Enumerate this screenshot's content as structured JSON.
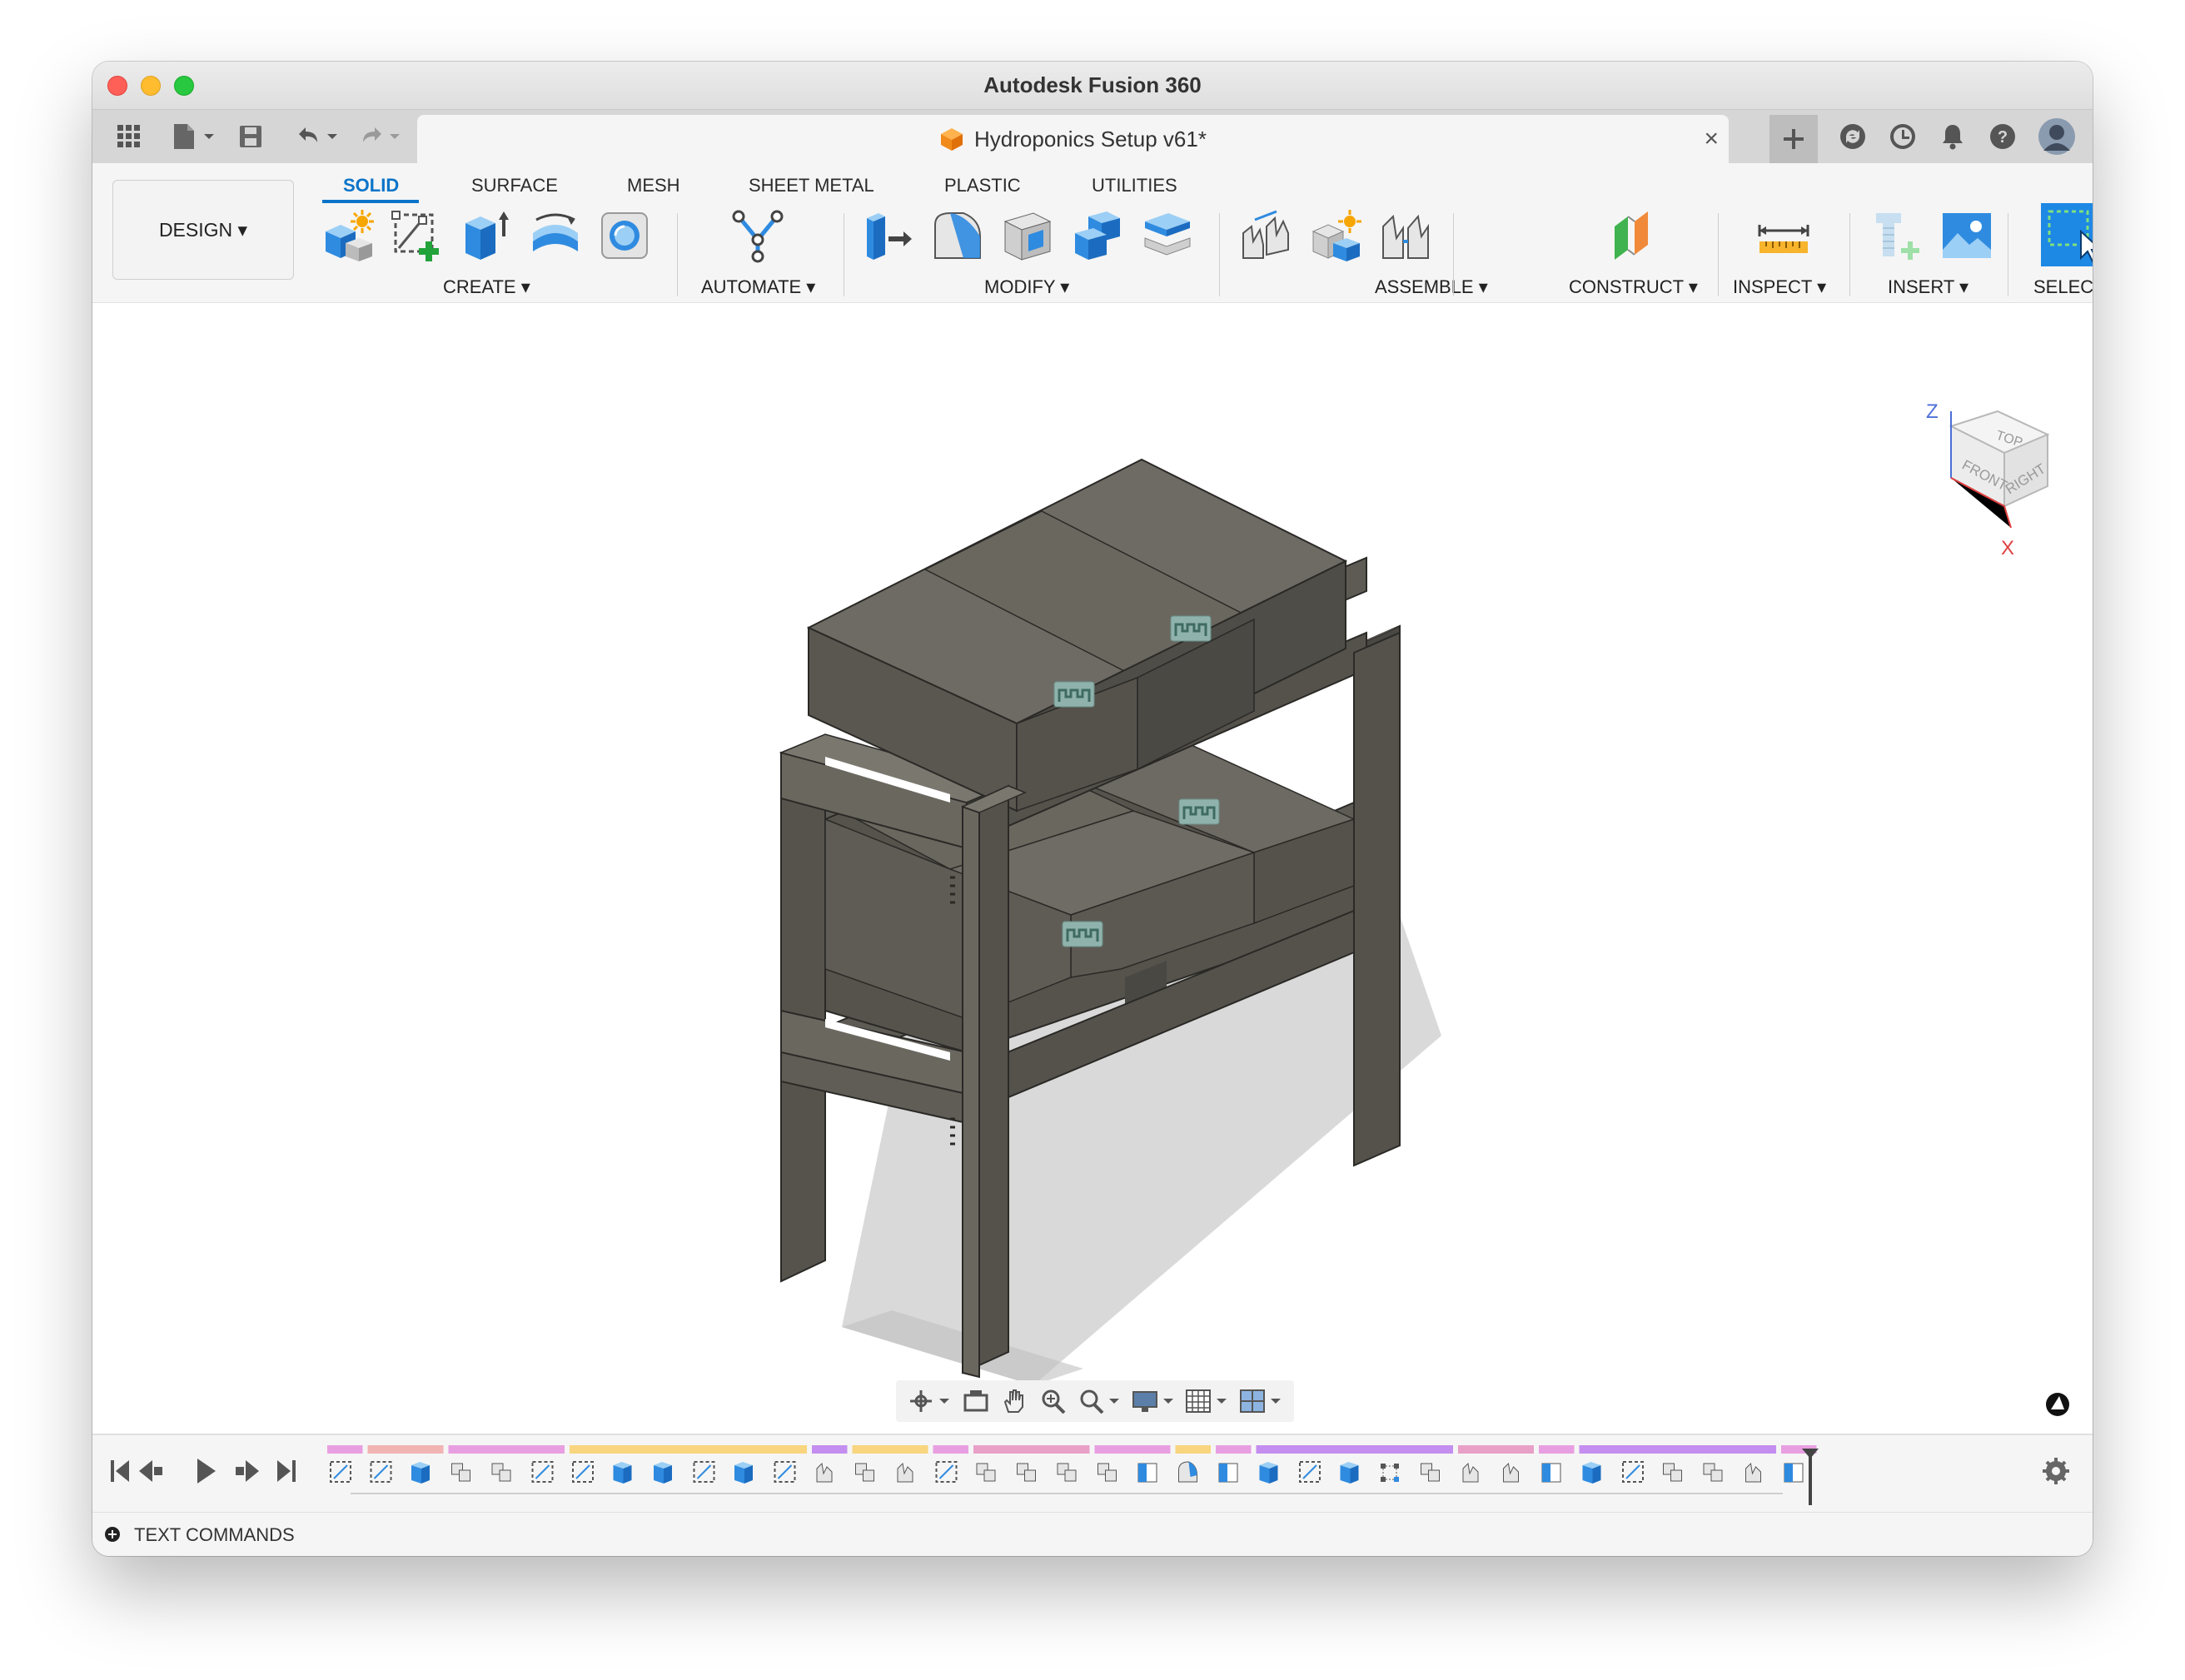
{
  "window": {
    "title": "Autodesk Fusion 360"
  },
  "document_tab": {
    "name": "Hydroponics Setup v61*"
  },
  "workspace": {
    "label": "DESIGN ▾"
  },
  "ribbon_tabs": [
    {
      "label": "SOLID",
      "active": true
    },
    {
      "label": "SURFACE",
      "active": false
    },
    {
      "label": "MESH",
      "active": false
    },
    {
      "label": "SHEET METAL",
      "active": false
    },
    {
      "label": "PLASTIC",
      "active": false
    },
    {
      "label": "UTILITIES",
      "active": false
    }
  ],
  "tool_groups": [
    {
      "label": "CREATE ▾",
      "tools": [
        "new-component",
        "create-sketch",
        "extrude",
        "revolve",
        "hole"
      ]
    },
    {
      "label": "AUTOMATE ▾",
      "tools": [
        "automate"
      ]
    },
    {
      "label": "MODIFY ▾",
      "tools": [
        "press-pull",
        "fillet",
        "shell",
        "combine",
        "offset-face"
      ]
    },
    {
      "label": "ASSEMBLE ▾",
      "tools": [
        "joint",
        "new-component-assemble",
        "as-built-joint"
      ]
    },
    {
      "label": "CONSTRUCT ▾",
      "tools": [
        "offset-plane"
      ]
    },
    {
      "label": "INSPECT ▾",
      "tools": [
        "measure"
      ]
    },
    {
      "label": "INSERT ▾",
      "tools": [
        "insert-mcmaster",
        "insert-canvas"
      ]
    },
    {
      "label": "SELECT ▾",
      "tools": [
        "select"
      ]
    }
  ],
  "viewcube": {
    "top": "TOP",
    "front": "FRONT",
    "right": "RIGHT",
    "z_axis": "Z",
    "x_axis": "X"
  },
  "text_commands": {
    "label": "TEXT COMMANDS"
  },
  "colors": {
    "accent": "#0a74c9",
    "model_dark": "#4e4c47",
    "model_mid": "#5f5c56",
    "model_light": "#6e6b64",
    "shadow": "#d2d2d2"
  },
  "timeline": {
    "group_colors": [
      "#e89fe1",
      "#f2b3b3",
      "#e89fe1",
      "#f8d57e",
      "#c48ef0",
      "#f8d57e",
      "#e89fe1",
      "#e8a0c7",
      "#e89fe1",
      "#f8d57e",
      "#e89fe1",
      "#c48ef0",
      "#e8a0c7",
      "#e89fe1",
      "#c48ef0",
      "#e89fe1"
    ],
    "features": [
      "sketch",
      "sketch",
      "extrude",
      "combine",
      "combine",
      "sketch",
      "sketch",
      "extrude",
      "extrude",
      "sketch",
      "extrude",
      "sketch",
      "joint",
      "combine",
      "joint",
      "sketch",
      "combine",
      "combine",
      "combine",
      "combine",
      "offset",
      "fillet",
      "offset",
      "extrude",
      "sketch",
      "extrude",
      "pattern",
      "combine",
      "joint",
      "joint",
      "offset",
      "extrude",
      "sketch",
      "combine",
      "combine",
      "joint",
      "offset"
    ]
  }
}
